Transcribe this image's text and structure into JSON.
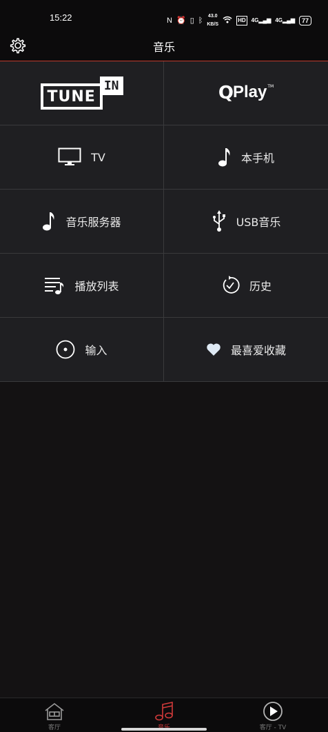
{
  "status_bar": {
    "time": "15:22",
    "net_speed_top": "43.0",
    "net_speed_bottom": "KB/S",
    "hd_badge": "HD",
    "signal_label_1": "4G",
    "signal_label_2": "4G",
    "battery": "77"
  },
  "header": {
    "title": "音乐"
  },
  "grid": {
    "tunein_tune": "TUNE",
    "tunein_in": "IN",
    "qplay_q": "Q",
    "qplay_play": "Play",
    "qplay_tm": "TM",
    "tv_label": "TV",
    "phone_label": "本手机",
    "music_server_label": "音乐服务器",
    "usb_label": "USB音乐",
    "playlist_label": "播放列表",
    "history_label": "历史",
    "input_label": "输入",
    "favorites_label": "最喜爱收藏"
  },
  "bottom_nav": {
    "items": [
      {
        "label": "客厅",
        "icon": "house-icon"
      },
      {
        "label": "音乐",
        "icon": "music-note-icon"
      },
      {
        "label": "客厅 - TV",
        "icon": "play-circle-icon"
      }
    ],
    "active_color": "#d23a3a"
  },
  "colors": {
    "background": "#141213",
    "cell": "#1f1f22",
    "divider": "#3a3a3c",
    "accent": "#c0392b"
  }
}
